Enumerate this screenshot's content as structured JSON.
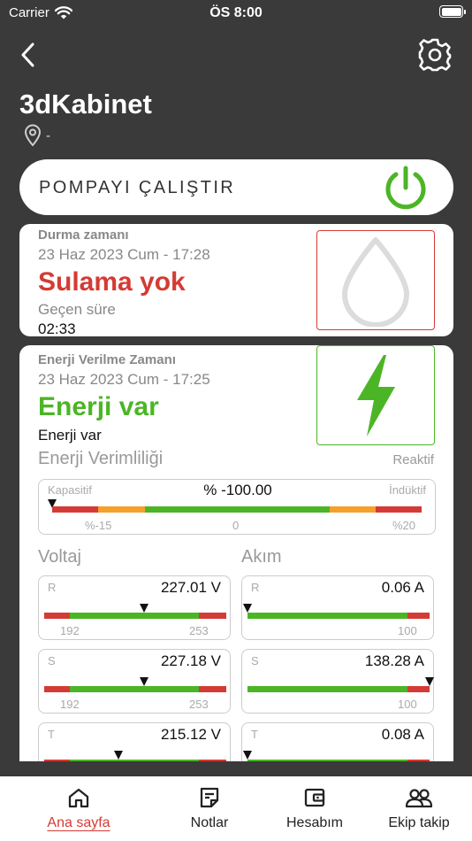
{
  "status_bar": {
    "carrier": "Carrier",
    "time": "ÖS 8:00"
  },
  "header": {
    "title": "3dKabinet",
    "location": "-"
  },
  "pump": {
    "label": "POMPAYI ÇALIŞTIR"
  },
  "stop_card": {
    "heading": "Durma zamanı",
    "date": "23 Haz 2023 Cum - 17:28",
    "status": "Sulama yok",
    "elapsed_label": "Geçen süre",
    "elapsed_value": "02:33"
  },
  "energy_card": {
    "heading": "Enerji Verilme Zamanı",
    "date": "23 Haz 2023 Cum - 17:25",
    "status": "Enerji var",
    "status_sub": "Enerji var",
    "efficiency_title": "Enerji Verimliliği",
    "reactive_label": "Reaktif",
    "efficiency": {
      "left_label": "Kapasitif",
      "right_label": "İndüktif",
      "value": "% -100.00",
      "ticks": [
        "%-15",
        "0",
        "%20"
      ],
      "marker_fraction": 0.0
    },
    "voltage_title": "Voltaj",
    "current_title": "Akım",
    "voltage": [
      {
        "phase": "R",
        "value": "227.01 V",
        "min": "192",
        "max": "253",
        "marker_fraction": 0.55
      },
      {
        "phase": "S",
        "value": "227.18 V",
        "min": "192",
        "max": "253",
        "marker_fraction": 0.55
      },
      {
        "phase": "T",
        "value": "215.12 V",
        "marker_fraction": 0.41
      }
    ],
    "current": [
      {
        "phase": "R",
        "value": "0.06 A",
        "max": "100",
        "marker_fraction": 0.0
      },
      {
        "phase": "S",
        "value": "138.28 A",
        "max": "100",
        "marker_fraction": 1.0
      },
      {
        "phase": "T",
        "value": "0.08 A",
        "marker_fraction": 0.0
      }
    ]
  },
  "tabs": [
    {
      "label": "Ana sayfa",
      "icon": "home-icon",
      "active": true
    },
    {
      "label": "Notlar",
      "icon": "notes-icon",
      "active": false
    },
    {
      "label": "Hesabım",
      "icon": "wallet-icon",
      "active": false
    },
    {
      "label": "Ekip takip",
      "icon": "team-icon",
      "active": false
    }
  ],
  "colors": {
    "accent_red": "#d43b34",
    "accent_green": "#4cb526",
    "warning_orange": "#f4a12c",
    "background_dark": "#3a3a3a"
  }
}
